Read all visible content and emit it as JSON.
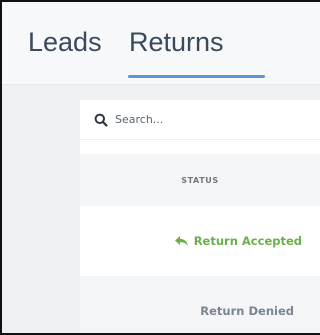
{
  "tabs": [
    {
      "label": "Leads",
      "active": false
    },
    {
      "label": "Returns",
      "active": true
    }
  ],
  "search": {
    "placeholder": "Search..."
  },
  "table": {
    "columns": [
      "STATUS"
    ],
    "rows": [
      {
        "status": "Return Accepted",
        "icon": "reply-icon",
        "color": "#6ab04c"
      },
      {
        "status": "Return Denied",
        "color": "#7a8590"
      }
    ]
  },
  "colors": {
    "accent": "#5b97d6",
    "success": "#6ab04c"
  }
}
